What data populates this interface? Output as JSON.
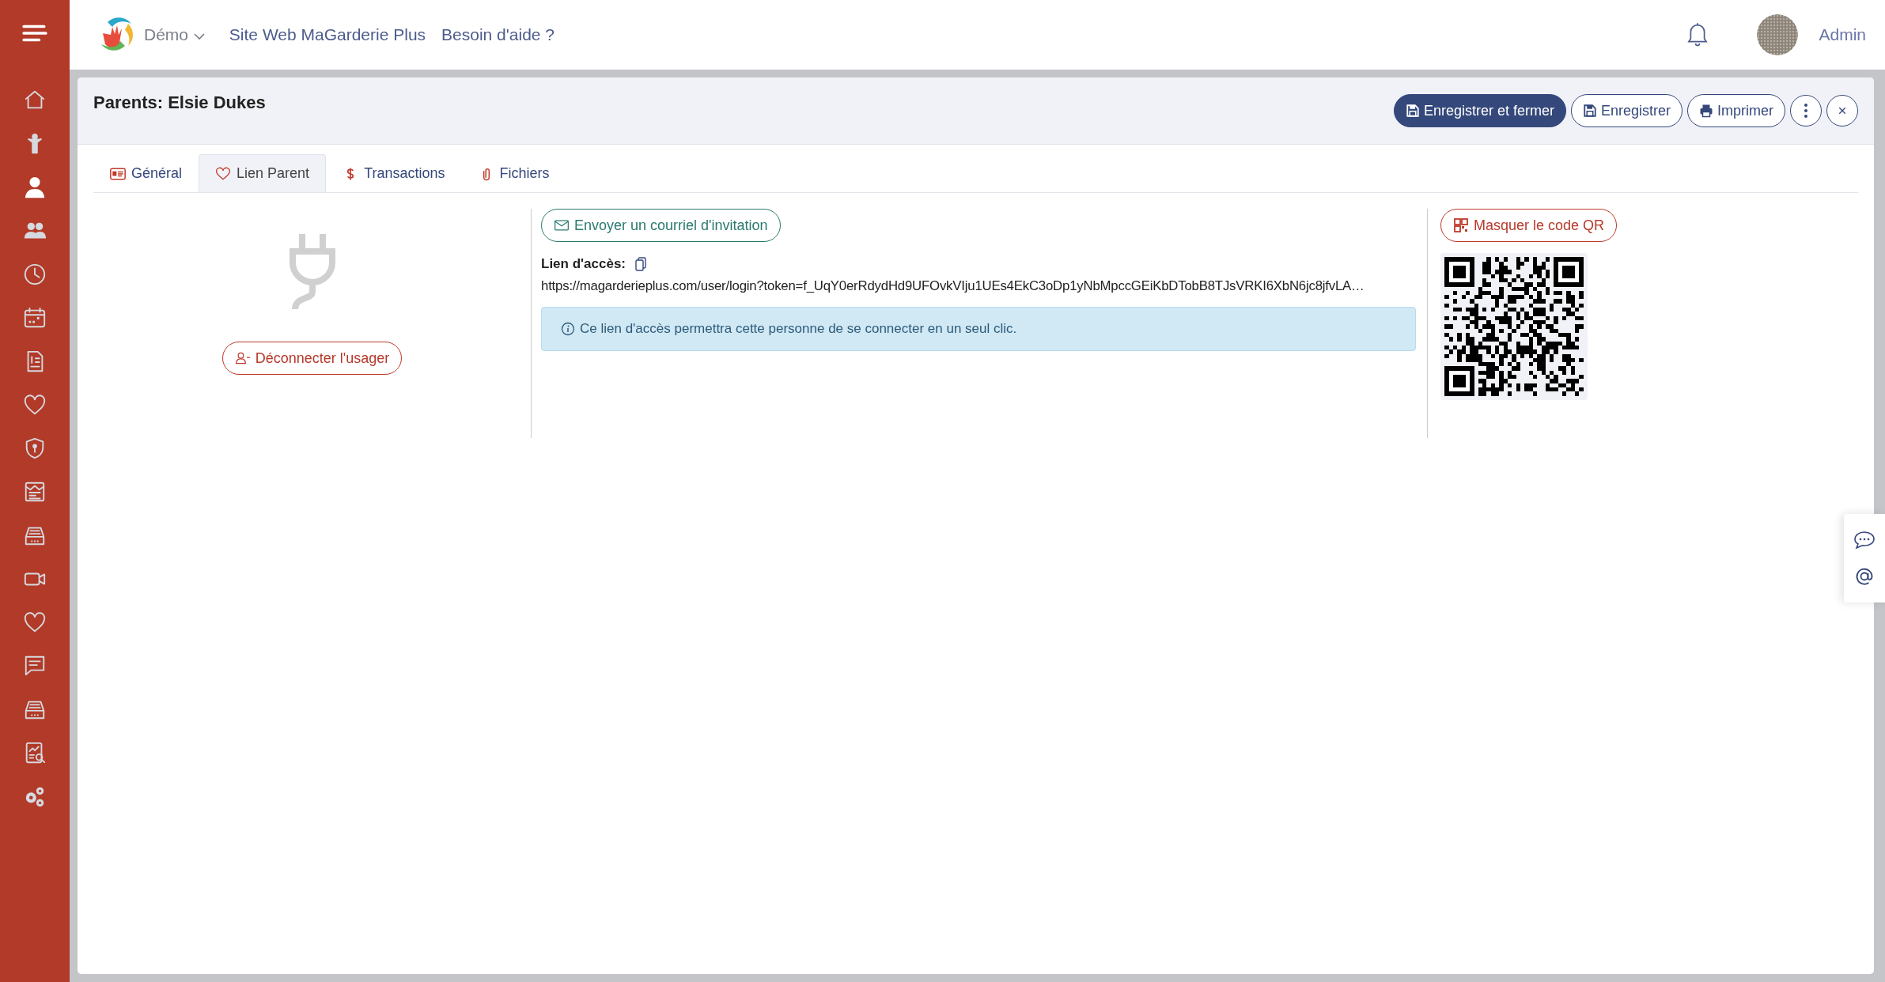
{
  "topbar": {
    "brand": "Démo",
    "links": [
      "Site Web MaGarderie Plus",
      "Besoin d'aide ?"
    ],
    "user": "Admin"
  },
  "sidebar": {
    "items": [
      {
        "selected": false
      },
      {
        "selected": false
      },
      {
        "selected": true
      },
      {
        "selected": false
      },
      {
        "selected": false
      },
      {
        "selected": false
      },
      {
        "selected": false
      },
      {
        "selected": false
      },
      {
        "selected": false
      },
      {
        "selected": false
      },
      {
        "selected": false
      },
      {
        "selected": false
      },
      {
        "selected": false
      },
      {
        "selected": false
      },
      {
        "selected": false
      },
      {
        "selected": false
      },
      {
        "selected": false
      }
    ]
  },
  "card": {
    "title": "Parents: Elsie Dukes",
    "buttons": [
      {
        "label": "Enregistrer et fermer",
        "kind": "primary"
      },
      {
        "label": "Enregistrer",
        "kind": "outline"
      },
      {
        "label": "Imprimer",
        "kind": "outline"
      }
    ]
  },
  "tabs": [
    {
      "label": "Général",
      "selected": false
    },
    {
      "label": "Lien Parent",
      "selected": true
    },
    {
      "label": "Transactions",
      "selected": false
    },
    {
      "label": "Fichiers",
      "selected": false
    }
  ],
  "connection": {
    "button": "Déconnecter l'usager"
  },
  "invitation": {
    "button": "Envoyer un courriel d'invitation",
    "link_label": "Lien d'accès:",
    "link": "https://magarderieplus.com/user/login?token=f_UqY0erRdydHd9UFOvkVIju1UEs4EkC3oDp1yNbMpccGEiKbDTobB8TJsVRKI6XbN6jc8jfvLA…",
    "info": "Ce lien d'accès permettra cette personne de se connecter en un seul clic."
  },
  "qr": {
    "button": "Masquer le code QR"
  }
}
